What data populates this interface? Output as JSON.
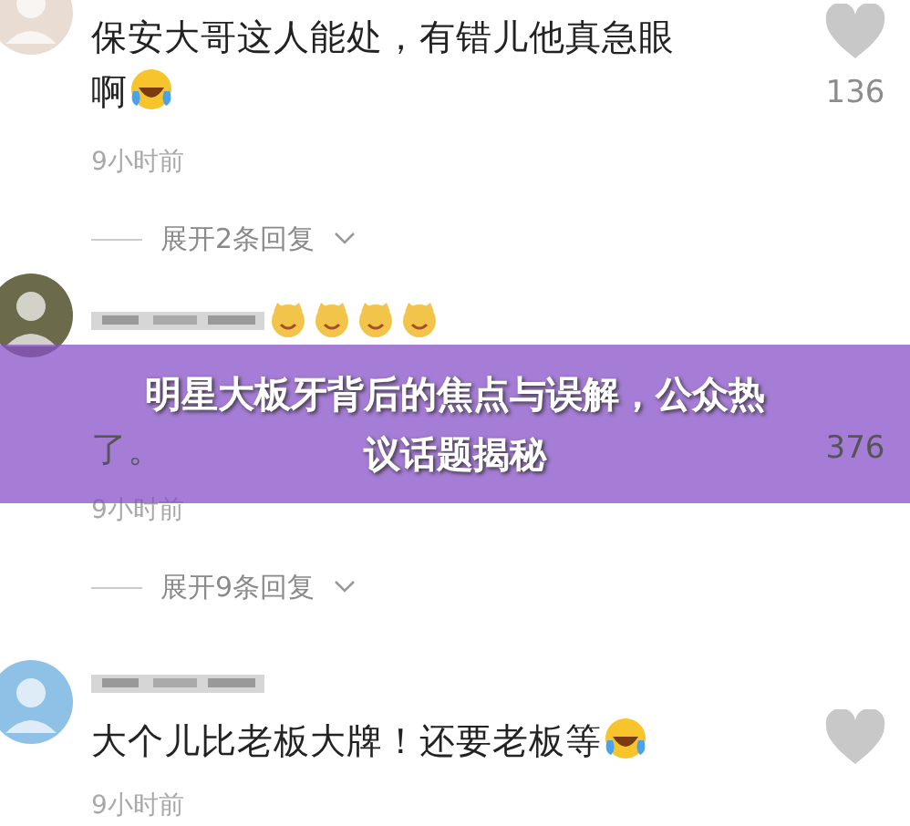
{
  "comments": [
    {
      "kind": "plain",
      "lines": [
        "保安大哥这人能处，有错儿他真急眼啊"
      ],
      "emoji": true,
      "time": "9小时前",
      "heart": true,
      "likes": "136",
      "replies": "展开2条回复"
    },
    {
      "kind": "badged",
      "lines": [
        "了。"
      ],
      "emoji": false,
      "time": "9小时前",
      "heart": false,
      "likes": "376",
      "replies": "展开9条回复"
    },
    {
      "kind": "plain",
      "lines": [
        "大个儿比老板大牌！还要老板等"
      ],
      "emoji": true,
      "time": "9小时前",
      "heart": true
    }
  ],
  "banner": {
    "title": "明星大板牙背后的焦点与误解，公众热议话题揭秘"
  }
}
